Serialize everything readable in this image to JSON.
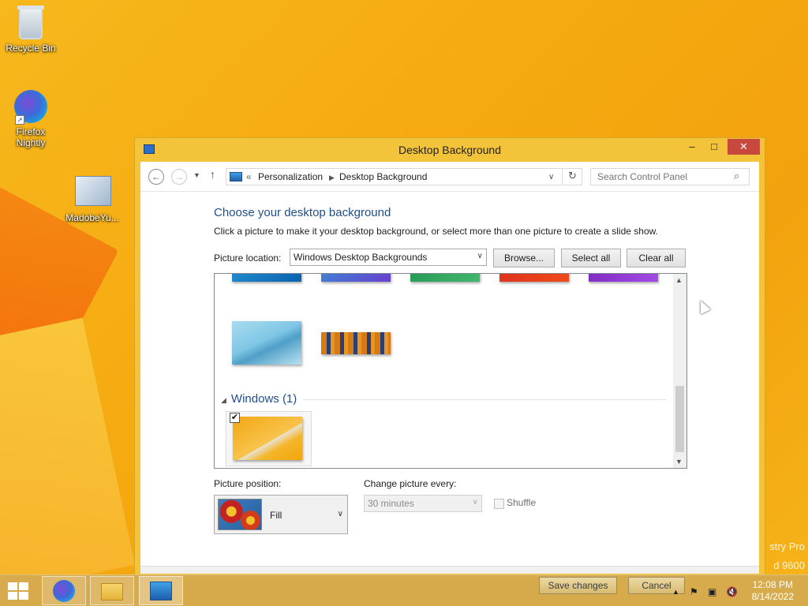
{
  "desktop": {
    "icons": [
      {
        "label": "Recycle Bin",
        "icon": "recycle-bin-icon"
      },
      {
        "label": "Firefox Nightly",
        "icon": "firefox-nightly-icon"
      },
      {
        "label": "MadobeYu...",
        "icon": "program-icon"
      }
    ],
    "watermark_line1": "stry Pro",
    "watermark_line2": "d 9600"
  },
  "window": {
    "title": "Desktop Background",
    "buttons": {
      "minimize": "–",
      "maximize": "□",
      "close": "✕"
    },
    "nav": {
      "breadcrumb_prefix": "«",
      "breadcrumb": [
        "Personalization",
        "Desktop Background"
      ],
      "search_placeholder": "Search Control Panel"
    },
    "heading": "Choose your desktop background",
    "subtitle": "Click a picture to make it your desktop background, or select more than one picture to create a slide show.",
    "picture_location_label": "Picture location:",
    "picture_location_value": "Windows Desktop Backgrounds",
    "buttons_row": {
      "browse": "Browse...",
      "select_all": "Select all",
      "clear_all": "Clear all"
    },
    "gallery": {
      "group_label": "Windows (1)",
      "selected_checked": true
    },
    "picture_position_label": "Picture position:",
    "picture_position_value": "Fill",
    "change_picture_label": "Change picture every:",
    "change_picture_value": "30 minutes",
    "shuffle_label": "Shuffle"
  },
  "taskbar": {
    "save_changes": "Save changes",
    "cancel": "Cancel",
    "time": "12:08 PM",
    "date": "8/14/2022"
  },
  "colors": {
    "accent_heading": "#1e4e8c",
    "window_frame": "#f3c33a",
    "close_button": "#c7483d"
  }
}
